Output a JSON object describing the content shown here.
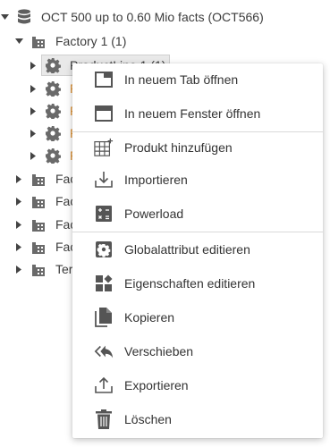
{
  "tree": {
    "root": {
      "label": "OCT 500 up to 0.60 Mio facts (OCT566)"
    },
    "factory1": {
      "label": "Factory 1 (1)"
    },
    "productline1": {
      "label": "ProductLine 1 (1)"
    },
    "children_partial": [
      "P",
      "P",
      "P",
      "P"
    ],
    "siblings": [
      "Fac",
      "Fac",
      "Fac",
      "Fac",
      "Ter"
    ]
  },
  "menu": {
    "items": [
      {
        "label": "In neuem Tab öffnen",
        "icon": "new-tab-icon"
      },
      {
        "label": "In neuem Fenster öffnen",
        "icon": "new-window-icon"
      },
      {
        "label": "Produkt hinzufügen",
        "icon": "add-product-grid-icon"
      },
      {
        "label": "Importieren",
        "icon": "import-icon"
      },
      {
        "label": "Powerload",
        "icon": "powerload-calculator-icon"
      },
      {
        "label": "Globalattribut editieren",
        "icon": "gear-icon"
      },
      {
        "label": "Eigenschaften editieren",
        "icon": "properties-icon"
      },
      {
        "label": "Kopieren",
        "icon": "copy-icon"
      },
      {
        "label": "Verschieben",
        "icon": "move-icon"
      },
      {
        "label": "Exportieren",
        "icon": "export-icon"
      },
      {
        "label": "Löschen",
        "icon": "trash-icon"
      }
    ]
  },
  "colors": {
    "icon_gray": "#5f5f5f",
    "partial_label_orange": "#e0912f",
    "selected_bg": "#e9e9e9"
  }
}
